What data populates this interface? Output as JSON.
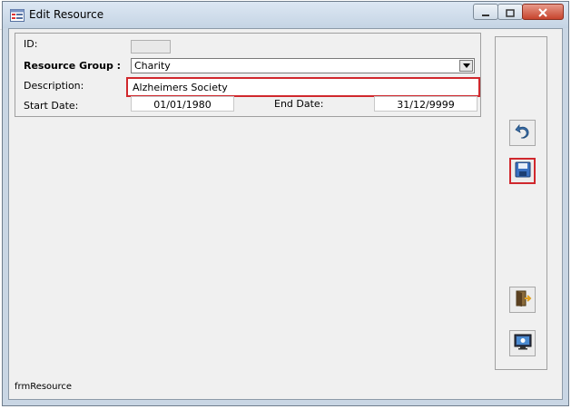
{
  "window": {
    "title": "Edit Resource",
    "icons": {
      "app": "form-icon",
      "minimize": "minimize-icon",
      "restore": "restore-icon",
      "close": "close-icon"
    }
  },
  "form": {
    "id_label": "ID:",
    "id_value": "",
    "resource_group_label": "Resource Group :",
    "resource_group_value": "Charity",
    "description_label": "Description:",
    "description_value": "Alzheimers Society",
    "start_date_label": "Start Date:",
    "start_date_value": "01/01/1980",
    "end_date_label": "End Date:",
    "end_date_value": "31/12/9999"
  },
  "side_buttons": [
    {
      "icon": "undo-icon"
    },
    {
      "icon": "save-icon"
    },
    {
      "icon": "exit-door-icon"
    },
    {
      "icon": "monitor-icon"
    }
  ],
  "footer": {
    "form_name": "frmResource"
  },
  "colors": {
    "highlight": "#d0282d",
    "titlebar": "#c9d6e4",
    "client_bg": "#f0f0f0"
  }
}
